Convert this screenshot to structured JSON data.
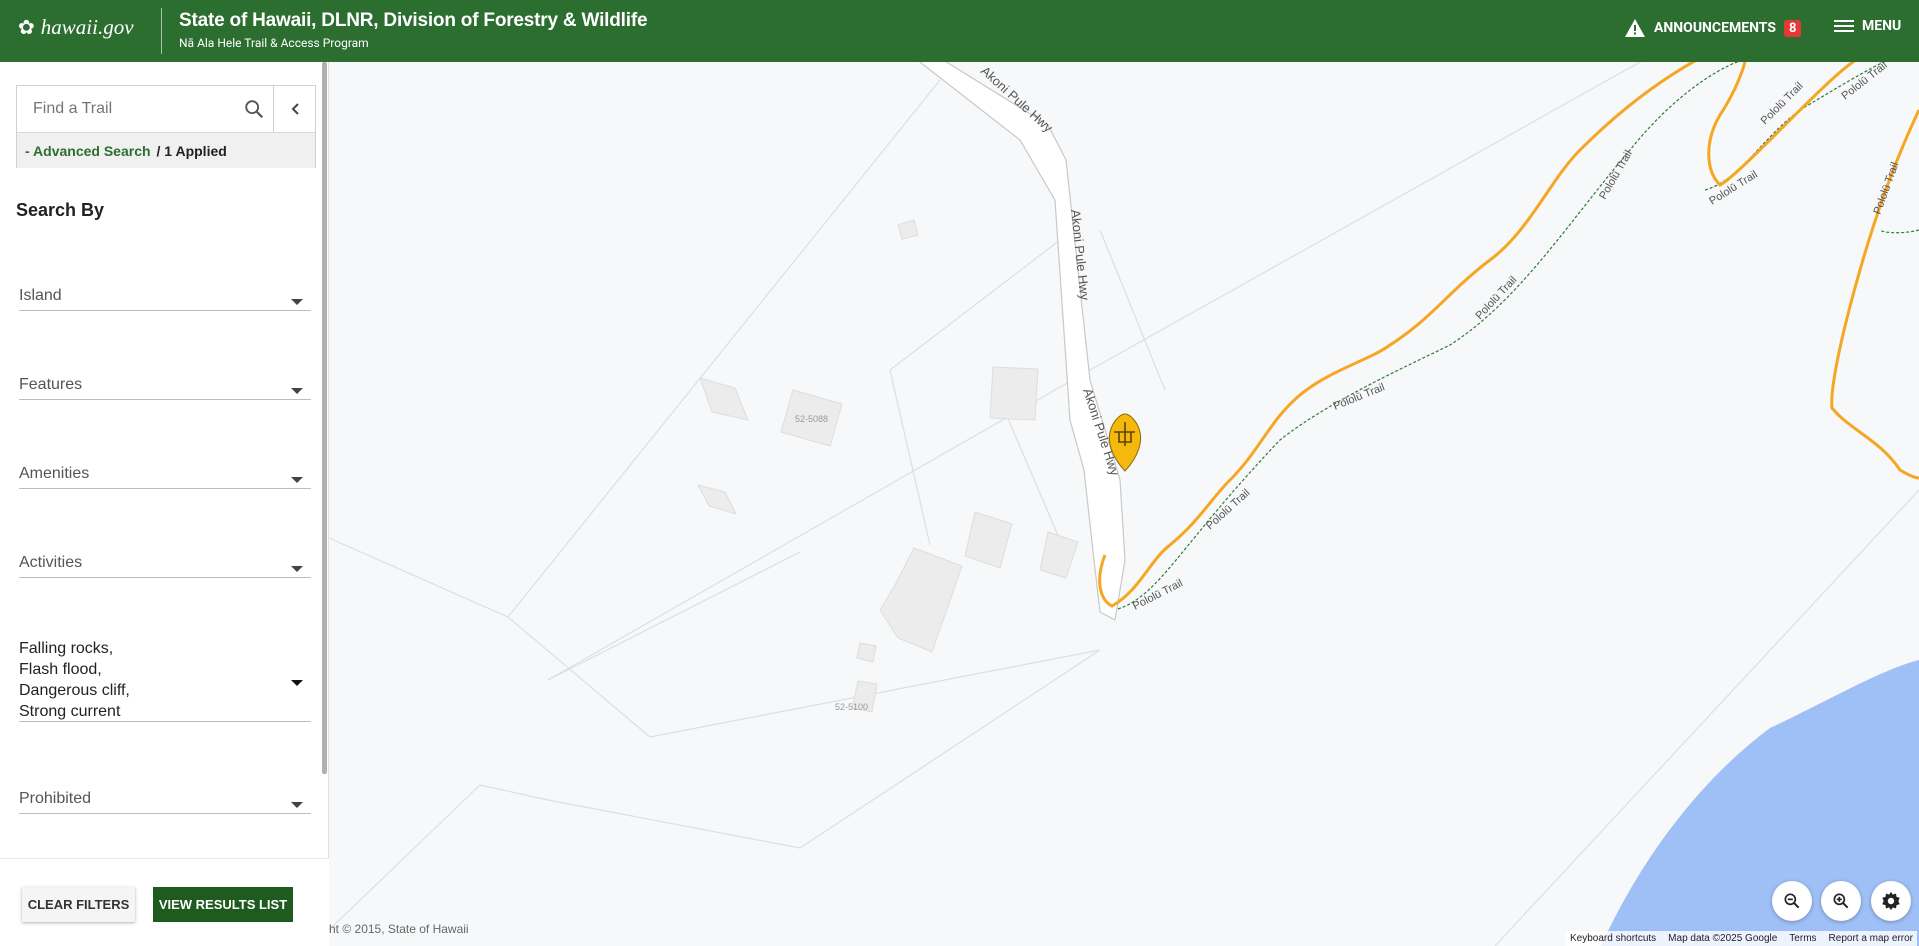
{
  "header": {
    "logo_text": "hawaii.gov",
    "title": "State of Hawaii, DLNR, Division of Forestry & Wildlife",
    "subtitle": "Nā Ala Hele Trail & Access Program",
    "announcements_label": "ANNOUNCEMENTS",
    "announcements_count": "8",
    "menu_label": "MENU"
  },
  "sidebar": {
    "search_placeholder": "Find a Trail",
    "advanced_search_label": "- Advanced Search",
    "applied_label": "/ 1 Applied",
    "search_by_title": "Search By",
    "filters": [
      {
        "label": "Island"
      },
      {
        "label": "Features"
      },
      {
        "label": "Amenities"
      },
      {
        "label": "Activities"
      },
      {
        "lines": [
          "Falling rocks,",
          "Flash flood,",
          "Dangerous cliff,",
          "Strong current"
        ]
      },
      {
        "label": "Prohibited"
      }
    ],
    "clear_filters_label": "CLEAR FILTERS",
    "view_results_label": "VIEW RESULTS LIST"
  },
  "map": {
    "road_name": "Akoni Pule Hwy",
    "trail_name": "Pololū Trail",
    "parcel_labels": [
      "52-5088",
      "52-5100"
    ],
    "copyright": "ht © 2015, State of Hawaii",
    "attribution": {
      "shortcuts": "Keyboard shortcuts",
      "map_data": "Map data ©2025 Google",
      "terms": "Terms",
      "report": "Report a map error"
    }
  },
  "colors": {
    "header_bg": "#2c6e30",
    "trail_orange": "#f5a623",
    "trail_dashed": "#2e7d32",
    "water": "#9fc0f7",
    "badge": "#e53935"
  }
}
